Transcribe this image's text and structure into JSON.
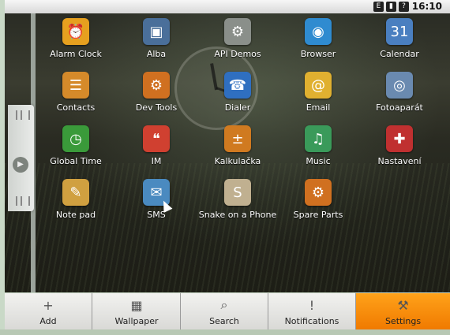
{
  "status_bar": {
    "time": "16:10"
  },
  "apps": [
    {
      "label": "Alarm Clock",
      "icon": "alarm-clock-icon",
      "glyph": "⏰",
      "color": "#e6a01f"
    },
    {
      "label": "Alba",
      "icon": "photo-album-icon",
      "glyph": "▣",
      "color": "#4a6f9a"
    },
    {
      "label": "API Demos",
      "icon": "folder-gear-icon",
      "glyph": "⚙",
      "color": "#8a8f8a"
    },
    {
      "label": "Browser",
      "icon": "globe-icon",
      "glyph": "◉",
      "color": "#2f8bd0"
    },
    {
      "label": "Calendar",
      "icon": "calendar-icon",
      "glyph": "31",
      "color": "#4a7fc0"
    },
    {
      "label": "Contacts",
      "icon": "contacts-icon",
      "glyph": "☰",
      "color": "#d58a2a"
    },
    {
      "label": "Dev Tools",
      "icon": "gear-icon",
      "glyph": "⚙",
      "color": "#d07020"
    },
    {
      "label": "Dialer",
      "icon": "phone-icon",
      "glyph": "☎",
      "color": "#2f6fc0"
    },
    {
      "label": "Email",
      "icon": "email-icon",
      "glyph": "@",
      "color": "#e0b030"
    },
    {
      "label": "Fotoaparát",
      "icon": "camera-icon",
      "glyph": "◎",
      "color": "#6a8ab0"
    },
    {
      "label": "Global Time",
      "icon": "world-clock-icon",
      "glyph": "◷",
      "color": "#3a9a3a"
    },
    {
      "label": "IM",
      "icon": "chat-bubbles-icon",
      "glyph": "❝",
      "color": "#d04030"
    },
    {
      "label": "Kalkulačka",
      "icon": "calculator-icon",
      "glyph": "±",
      "color": "#d07a20"
    },
    {
      "label": "Music",
      "icon": "music-icon",
      "glyph": "♫",
      "color": "#3a9a5a"
    },
    {
      "label": "Nastavení",
      "icon": "settings-tools-icon",
      "glyph": "✚",
      "color": "#c03030"
    },
    {
      "label": "Note pad",
      "icon": "notepad-icon",
      "glyph": "✎",
      "color": "#d0a040"
    },
    {
      "label": "SMS",
      "icon": "sms-icon",
      "glyph": "✉",
      "color": "#4a8ac0"
    },
    {
      "label": "Snake on a Phone",
      "icon": "snake-game-icon",
      "glyph": "S",
      "color": "#c0b090"
    },
    {
      "label": "Spare Parts",
      "icon": "spare-parts-gear-icon",
      "glyph": "⚙",
      "color": "#d07020"
    }
  ],
  "dock": [
    {
      "label": "Add",
      "icon": "add-icon",
      "glyph": "+"
    },
    {
      "label": "Wallpaper",
      "icon": "wallpaper-icon",
      "glyph": "▦"
    },
    {
      "label": "Search",
      "icon": "search-icon",
      "glyph": "⌕"
    },
    {
      "label": "Notifications",
      "icon": "notification-icon",
      "glyph": "!"
    },
    {
      "label": "Settings",
      "icon": "settings-icon",
      "glyph": "⚒"
    }
  ],
  "active_dock": "Settings"
}
